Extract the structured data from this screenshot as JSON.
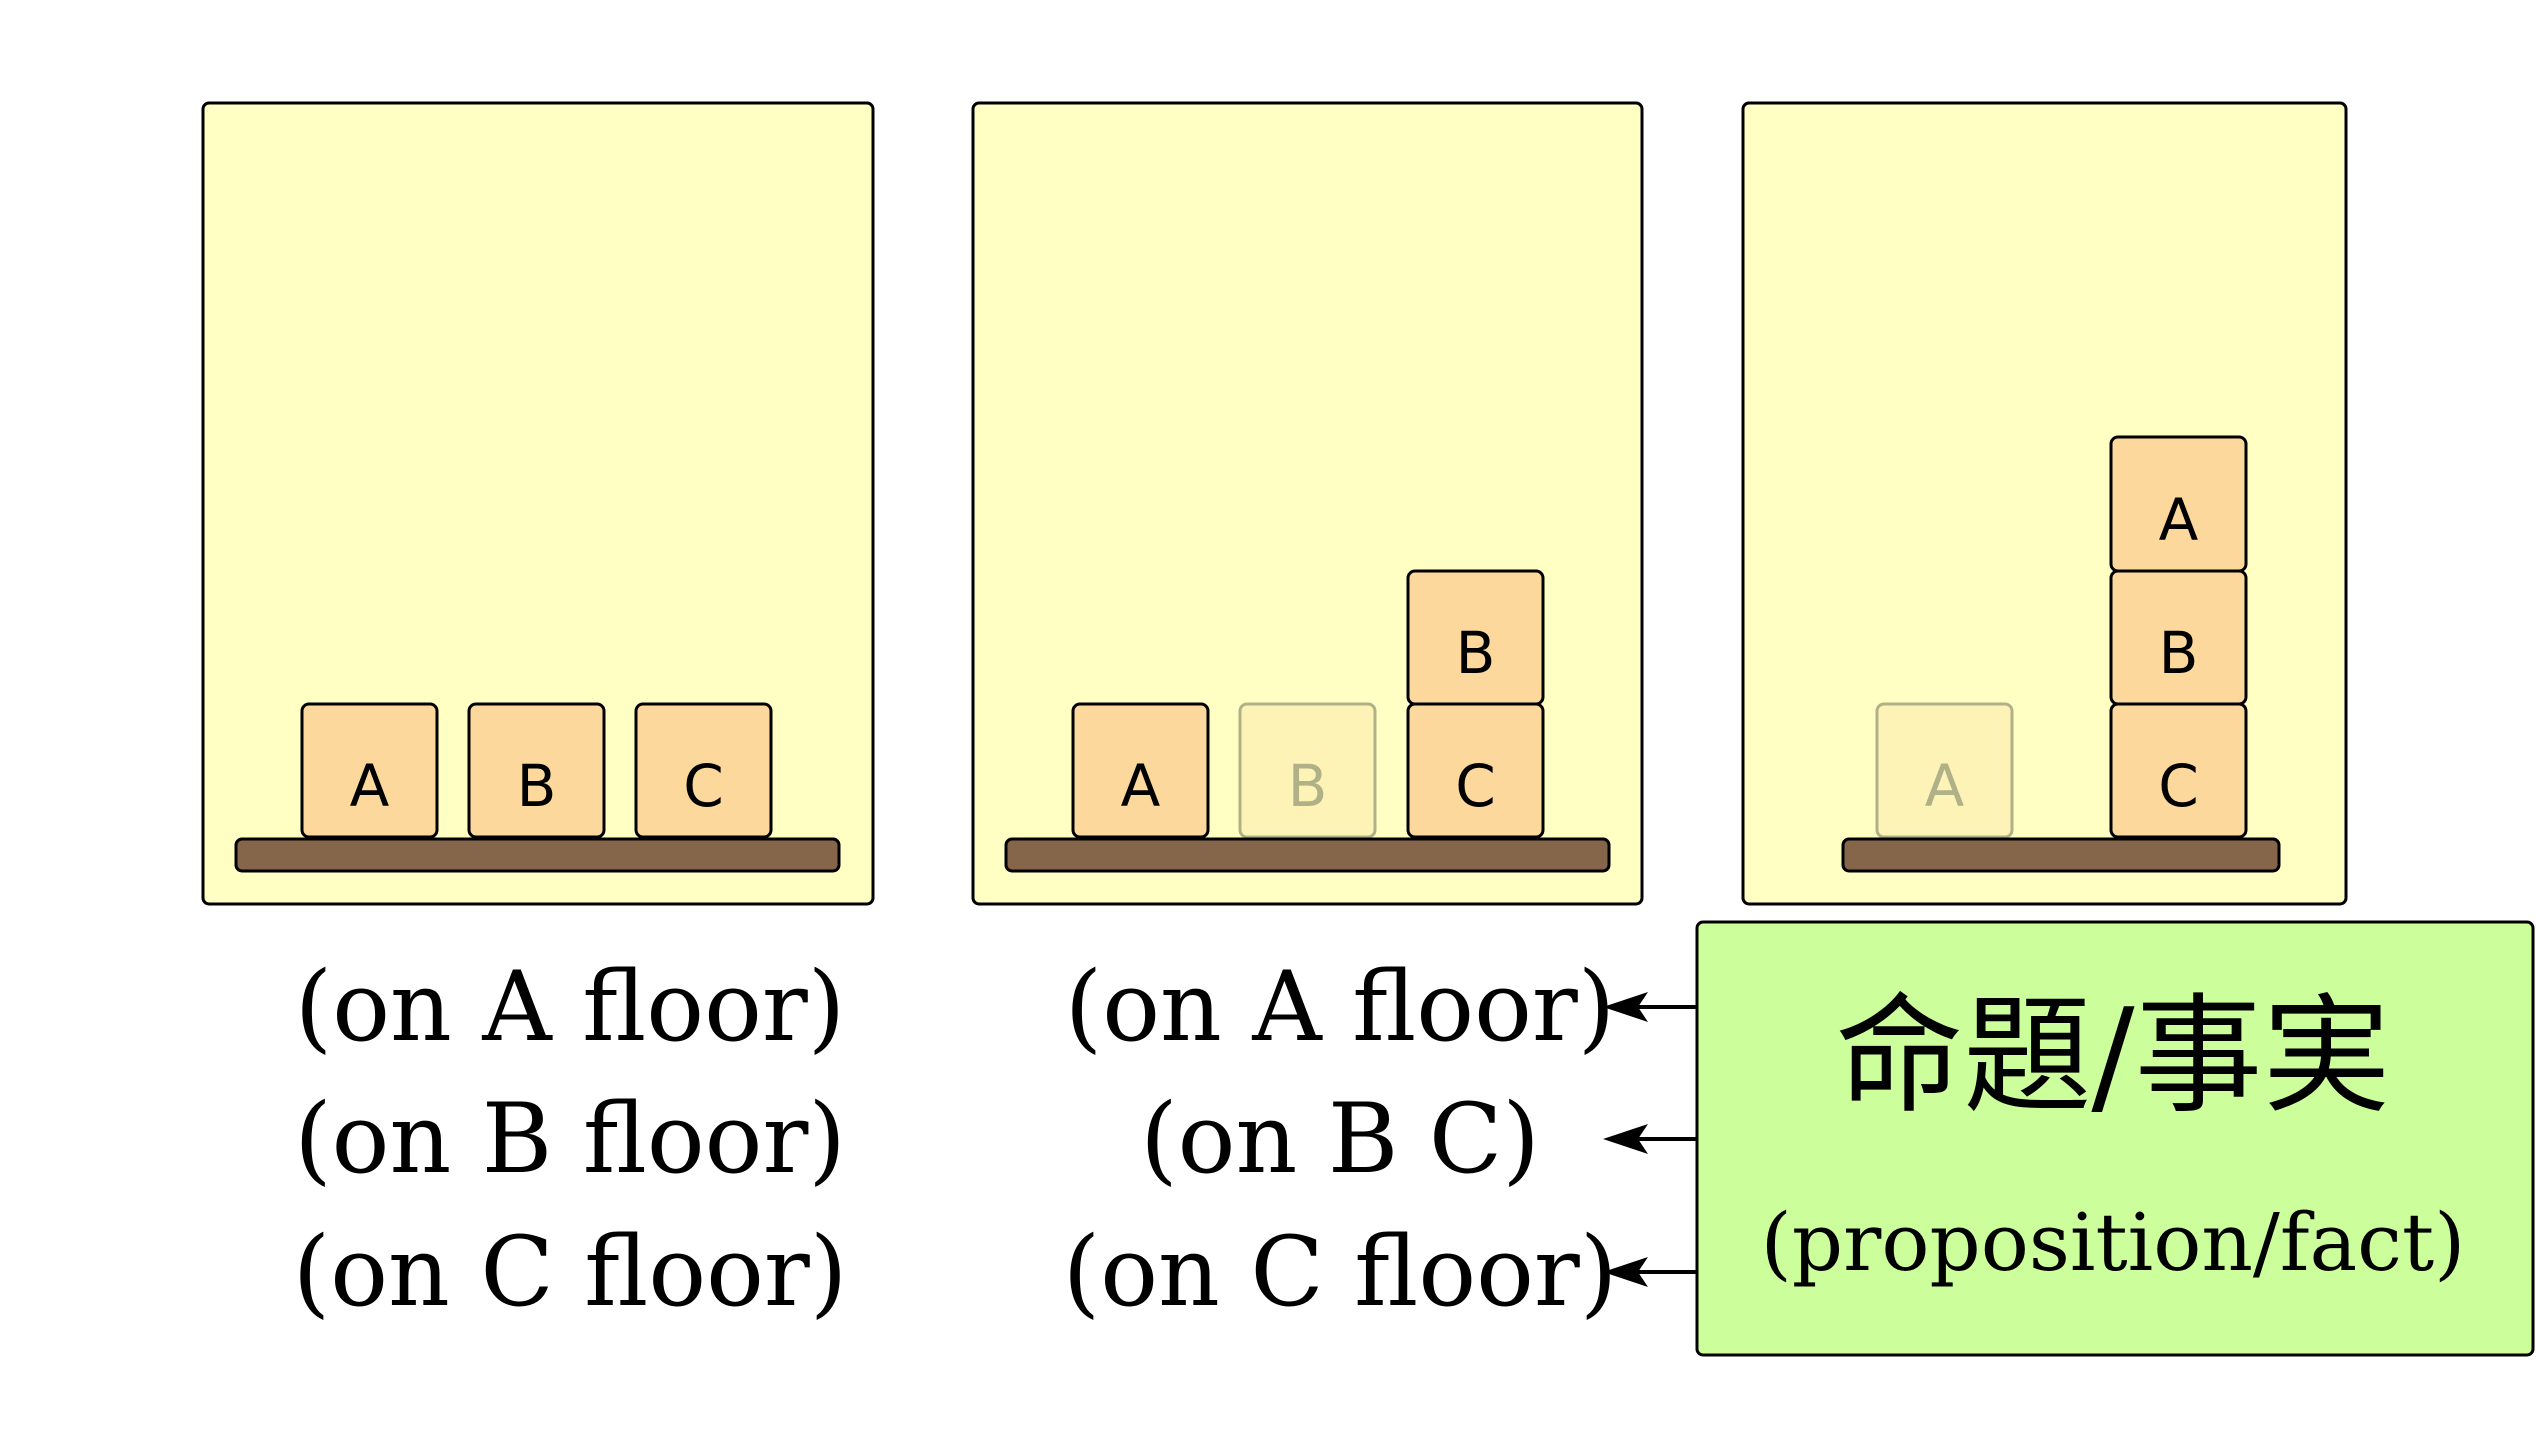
{
  "panels": [
    {
      "blocks": [
        {
          "label": "A",
          "ghost": false
        },
        {
          "label": "B",
          "ghost": false
        },
        {
          "label": "C",
          "ghost": false
        }
      ],
      "facts": [
        "(on A floor)",
        "(on B floor)",
        "(on C floor)"
      ]
    },
    {
      "blocks": [
        {
          "label": "A",
          "ghost": false
        },
        {
          "label": "B",
          "ghost": true
        },
        {
          "label": "C",
          "ghost": false
        },
        {
          "label": "B",
          "ghost": false
        }
      ],
      "facts": [
        "(on A floor)",
        "(on B C)",
        "(on C floor)"
      ]
    },
    {
      "blocks": [
        {
          "label": "A",
          "ghost": true
        },
        {
          "label": "C",
          "ghost": false
        },
        {
          "label": "B",
          "ghost": false
        },
        {
          "label": "A",
          "ghost": false
        }
      ],
      "facts": []
    }
  ],
  "callout": {
    "title": "命題/事実",
    "subtitle": "(proposition/fact)"
  },
  "colors": {
    "panel_fill": "#ffffc4",
    "block_fill": "#fcd89c",
    "floor_fill": "#86664a",
    "callout_fill": "#ccff9c"
  }
}
